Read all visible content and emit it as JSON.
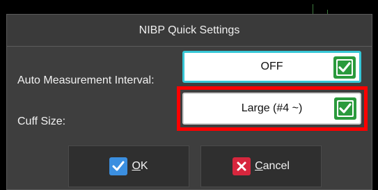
{
  "dialog": {
    "title": "NIBP Quick Settings"
  },
  "rows": [
    {
      "label": "Auto Measurement Interval:",
      "value": "OFF",
      "icon": "checkmark-icon"
    },
    {
      "label": "Cuff Size:",
      "value": "Large (#4 ~)",
      "icon": "checkmark-icon"
    }
  ],
  "buttons": {
    "ok": {
      "mnemonic": "O",
      "rest": "K",
      "icon": "ok-check-icon"
    },
    "cancel": {
      "mnemonic": "C",
      "rest": "ancel",
      "icon": "cancel-x-icon"
    }
  },
  "colors": {
    "focus_border": "#37c7d6",
    "highlight": "#ff0000",
    "check_green": "#2a9a3c",
    "ok_blue": "#3b8fe0",
    "cancel_red": "#d7263d"
  }
}
